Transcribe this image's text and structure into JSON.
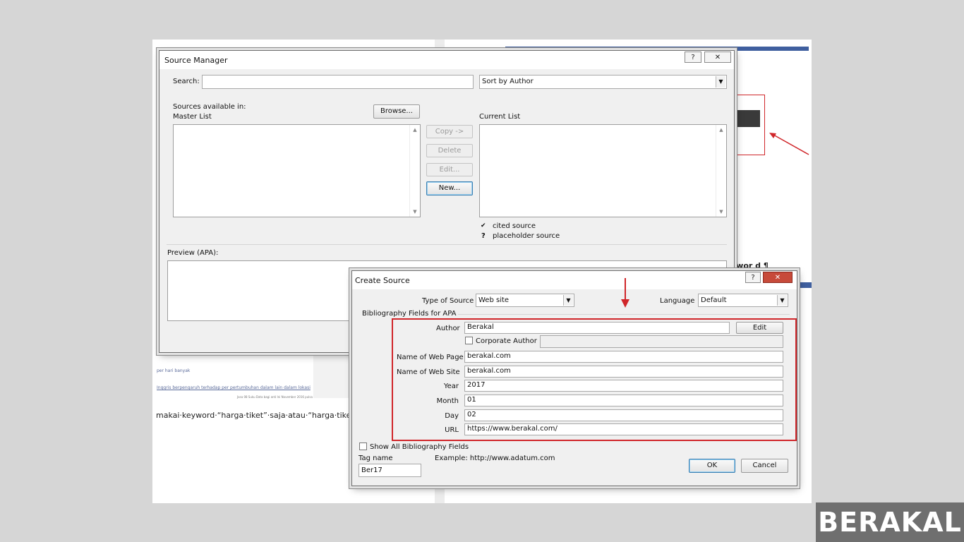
{
  "background_document": {
    "body_text": "makai·keyword·“harga·tiket”·saja·atau·“harga·tiket·",
    "link_1": "per hari banyak",
    "link_2": "Inggris berpengaruh terhadap per pertumbuhan dalam lain dalam lokasi",
    "small_1": "Jasa 08 Suku Data bagi anti Ini November 2016 pulsa Hall bisa",
    "side_keyword": "ywor d ¶"
  },
  "source_manager": {
    "title": "Source Manager",
    "help_label": "?",
    "close_label": "✕",
    "search_label": "Search:",
    "search_value": "",
    "sort_value": "Sort by Author",
    "sources_available_label": "Sources available in:",
    "browse_label": "Browse...",
    "master_list_label": "Master List",
    "current_list_label": "Current List",
    "buttons": {
      "copy": "Copy ->",
      "delete": "Delete",
      "edit": "Edit...",
      "new": "New..."
    },
    "legend": [
      {
        "symbol": "✔",
        "text": "cited source"
      },
      {
        "symbol": "?",
        "text": "placeholder source"
      }
    ],
    "preview_label": "Preview (APA):"
  },
  "create_source": {
    "title": "Create Source",
    "help_label": "?",
    "close_label": "✕",
    "type_of_source_label": "Type of Source",
    "type_of_source_value": "Web site",
    "language_label": "Language",
    "language_value": "Default",
    "bibliography_fields_label": "Bibliography Fields for APA",
    "author_label": "Author",
    "author_value": "Berakal",
    "edit_label": "Edit",
    "corporate_author_label": "Corporate Author",
    "corporate_author_checked": false,
    "corporate_author_value": "",
    "fields": [
      {
        "label": "Name of Web Page",
        "value": "berakal.com"
      },
      {
        "label": "Name of Web Site",
        "value": "berakal.com"
      },
      {
        "label": "Year",
        "value": "2017"
      },
      {
        "label": "Month",
        "value": "01"
      },
      {
        "label": "Day",
        "value": "02"
      },
      {
        "label": "URL",
        "value": "https://www.berakal.com/"
      }
    ],
    "show_all_label": "Show All Bibliography Fields",
    "show_all_checked": false,
    "tag_name_label": "Tag name",
    "tag_name_value": "Ber17",
    "example_text": "Example: http://www.adatum.com",
    "ok_label": "OK",
    "cancel_label": "Cancel"
  },
  "watermark": "BERAKAL",
  "colors": {
    "highlight": "#d0262a",
    "default_button_border": "#3c7fb1",
    "close_button": "#c74a3a"
  }
}
